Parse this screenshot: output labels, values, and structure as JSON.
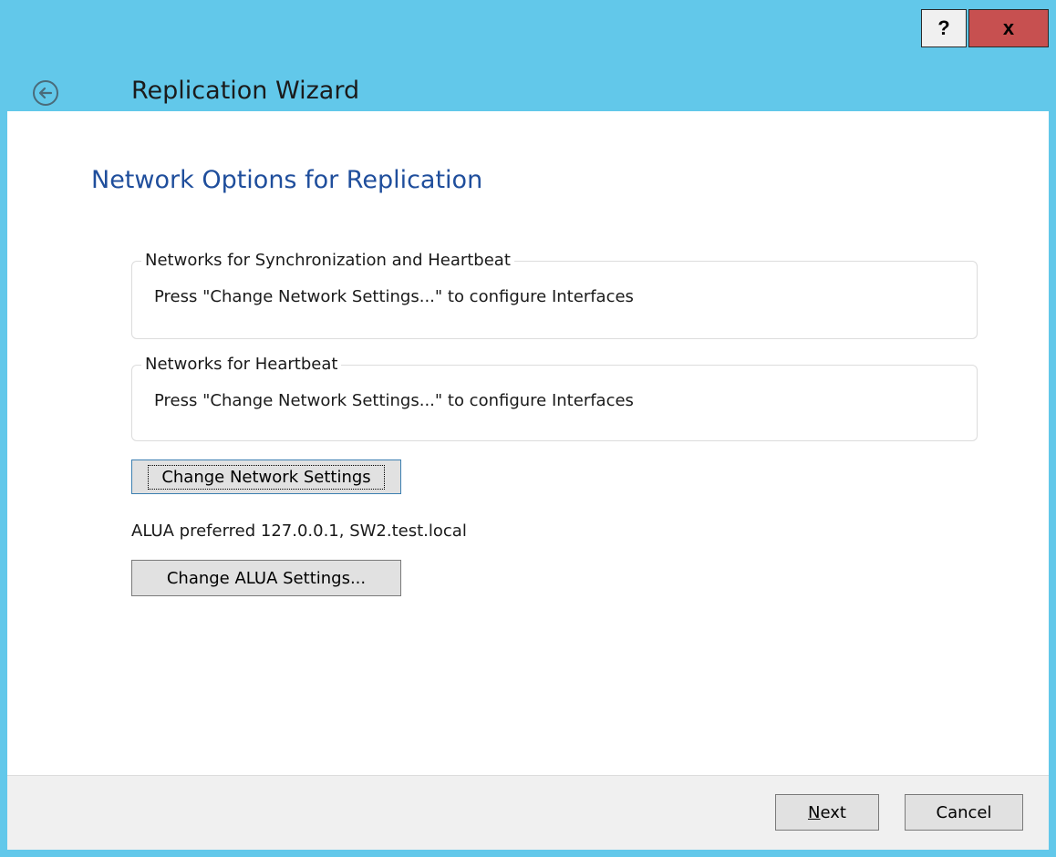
{
  "window": {
    "title": "Replication Wizard",
    "help_label": "?",
    "close_label": "x"
  },
  "page": {
    "heading": "Network Options for Replication"
  },
  "groups": {
    "sync": {
      "legend": "Networks for Synchronization and Heartbeat",
      "text": "Press \"Change Network Settings...\" to configure Interfaces"
    },
    "heartbeat": {
      "legend": "Networks for Heartbeat",
      "text": "Press \"Change Network Settings...\" to configure Interfaces"
    }
  },
  "buttons": {
    "change_network": "Change Network Settings",
    "change_alua": "Change ALUA Settings...",
    "next_mnemonic": "N",
    "next_rest": "ext",
    "cancel": "Cancel"
  },
  "alua": {
    "status": "ALUA preferred 127.0.0.1, SW2.test.local"
  },
  "colors": {
    "accent": "#62c8ea",
    "heading": "#1f4e9c",
    "close": "#c75050"
  }
}
